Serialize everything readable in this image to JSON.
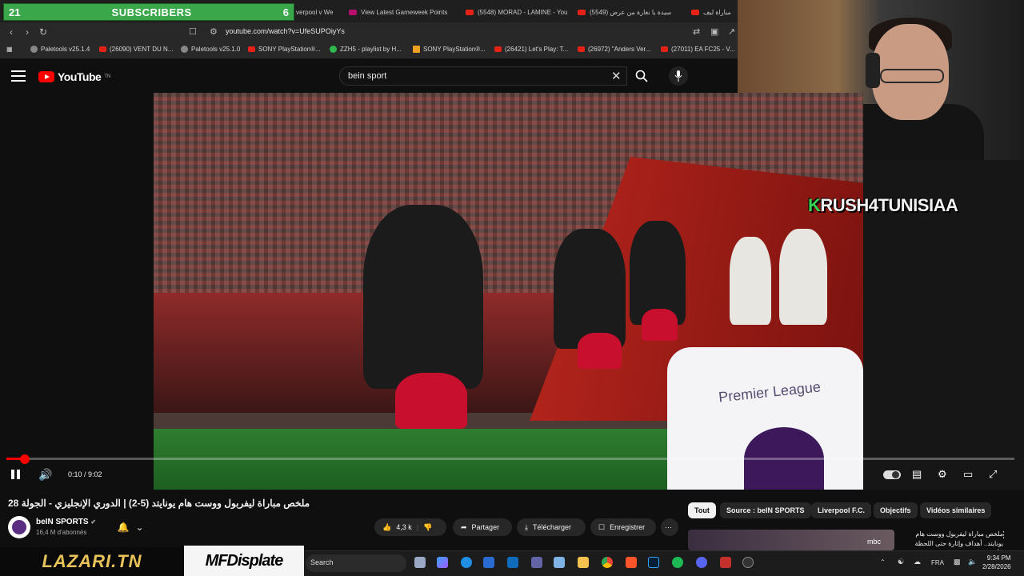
{
  "overlay": {
    "subs_count_left": "21",
    "subs_label": "SUBSCRIBERS",
    "subs_count_right": "6",
    "streamer_k": "K",
    "streamer_rest": "RUSH4TUNISIAA",
    "sponsor_left": "LAZARI.TN",
    "sponsor_right": "MFDisplate"
  },
  "browser": {
    "tabs": [
      {
        "label": "verpool v We"
      },
      {
        "label": "View Latest Gameweek Points"
      },
      {
        "label": "(5548) MORAD - LAMINE - You"
      },
      {
        "label": "سيدة يا نغارة من عرض (5549)"
      },
      {
        "label": "مباراة ليف"
      }
    ],
    "url": "youtube.com/watch?v=UfeSUPOiyYs",
    "bookmarks": [
      {
        "label": "Paletools v25.1.4",
        "icon": "globe"
      },
      {
        "label": "(26090) VENT DU N...",
        "icon": "youtube"
      },
      {
        "label": "Paletools v25.1.0",
        "icon": "globe"
      },
      {
        "label": "SONY PlayStation®...",
        "icon": "youtube"
      },
      {
        "label": "ZZH5 - playlist by H...",
        "icon": "spotify"
      },
      {
        "label": "SONY PlayStation®...",
        "icon": "amazon"
      },
      {
        "label": "(26421) Let's Play: T...",
        "icon": "youtube"
      },
      {
        "label": "(26972) \"Anders Ver...",
        "icon": "youtube"
      },
      {
        "label": "(27011) EA FC25 - V...",
        "icon": "youtube"
      }
    ]
  },
  "youtube": {
    "logo_text": "YouTube",
    "logo_sup": "TN",
    "search_value": "bein sport",
    "video": {
      "time": "0:10 / 9:02",
      "progress": 0.0185,
      "board_text": "Premier League"
    },
    "title": "ملخص مباراة ليفربول ووست هام يونايتد (5-2) | الدوري الإنجليزي - الجولة 28",
    "channel": {
      "name": "beIN SPORTS",
      "subs": "16,4 M d'abonnés"
    },
    "actions": {
      "likes": "4,3 k",
      "share": "Partager",
      "download": "Télécharger",
      "save": "Enregistrer"
    },
    "chips": [
      "Tout",
      "Source : beIN SPORTS",
      "Liverpool F.C.",
      "Objectifs",
      "Vidéos similaires"
    ],
    "recommendation": {
      "badge": "mbc",
      "text": "ملخص مباراة ليفربول ووست هام يونايتد.. أهداف وإثارة حتى اللحظة الأخيرة في ..."
    }
  },
  "taskbar": {
    "search_placeholder": "Search",
    "lang": "FRA",
    "time": "9:34 PM",
    "date": "2/28/2026"
  },
  "colors": {
    "accent_red": "#ff0000",
    "subs_green": "#3aa84a",
    "streamer_green": "#39d353"
  }
}
